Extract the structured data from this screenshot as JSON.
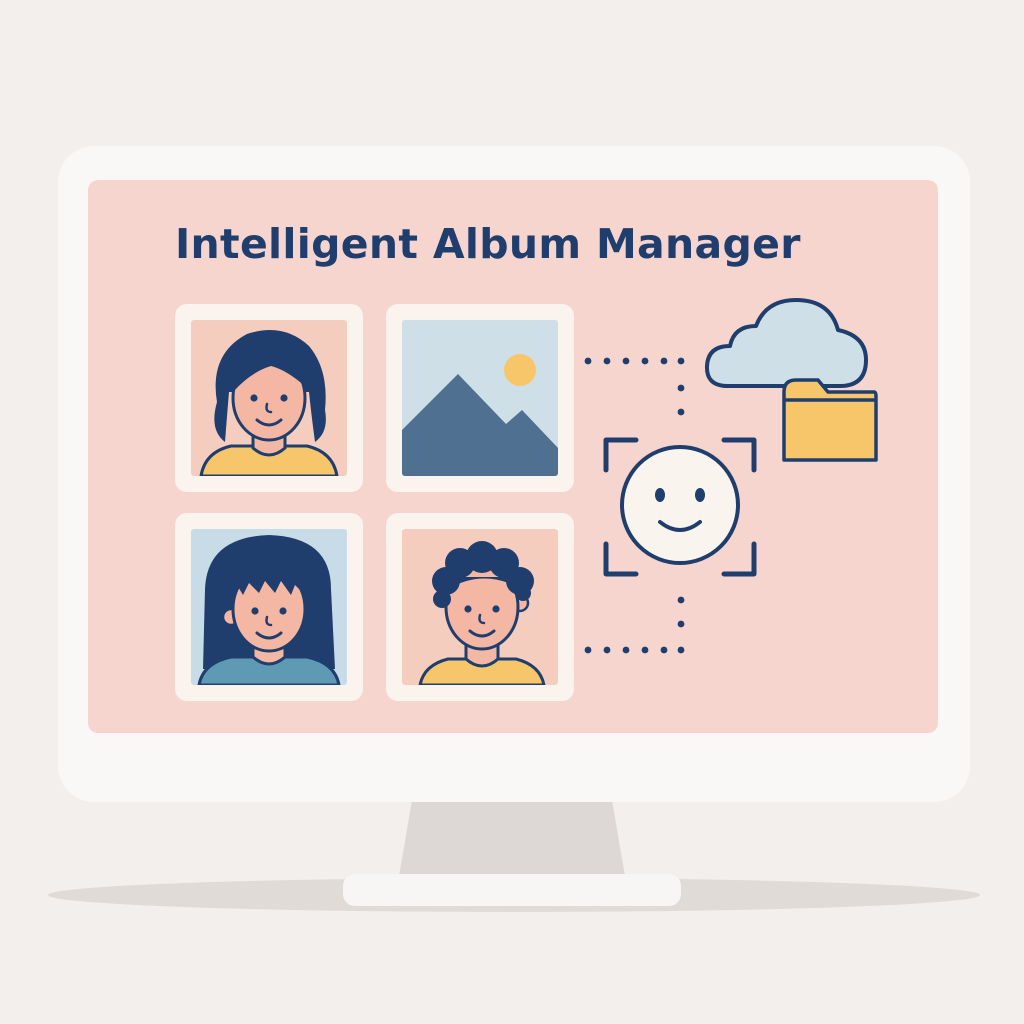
{
  "app": {
    "title": "Intelligent Album Manager"
  },
  "photos": [
    {
      "subject": "girl-portrait",
      "background": "#f5cdbf"
    },
    {
      "subject": "landscape",
      "background": "#cfdfe8"
    },
    {
      "subject": "woman-portrait",
      "background": "#c7dce6"
    },
    {
      "subject": "boy-portrait",
      "background": "#f5cdbf"
    }
  ],
  "icons": {
    "cloud": "cloud-icon",
    "folder": "folder-icon",
    "face_scan": "face-recognition-icon"
  },
  "colors": {
    "navy": "#203e6d",
    "screen": "#f7d5cf",
    "yellow": "#f7c66a",
    "cloud_fill": "#cfdfe8",
    "frame": "#faf8f6"
  }
}
